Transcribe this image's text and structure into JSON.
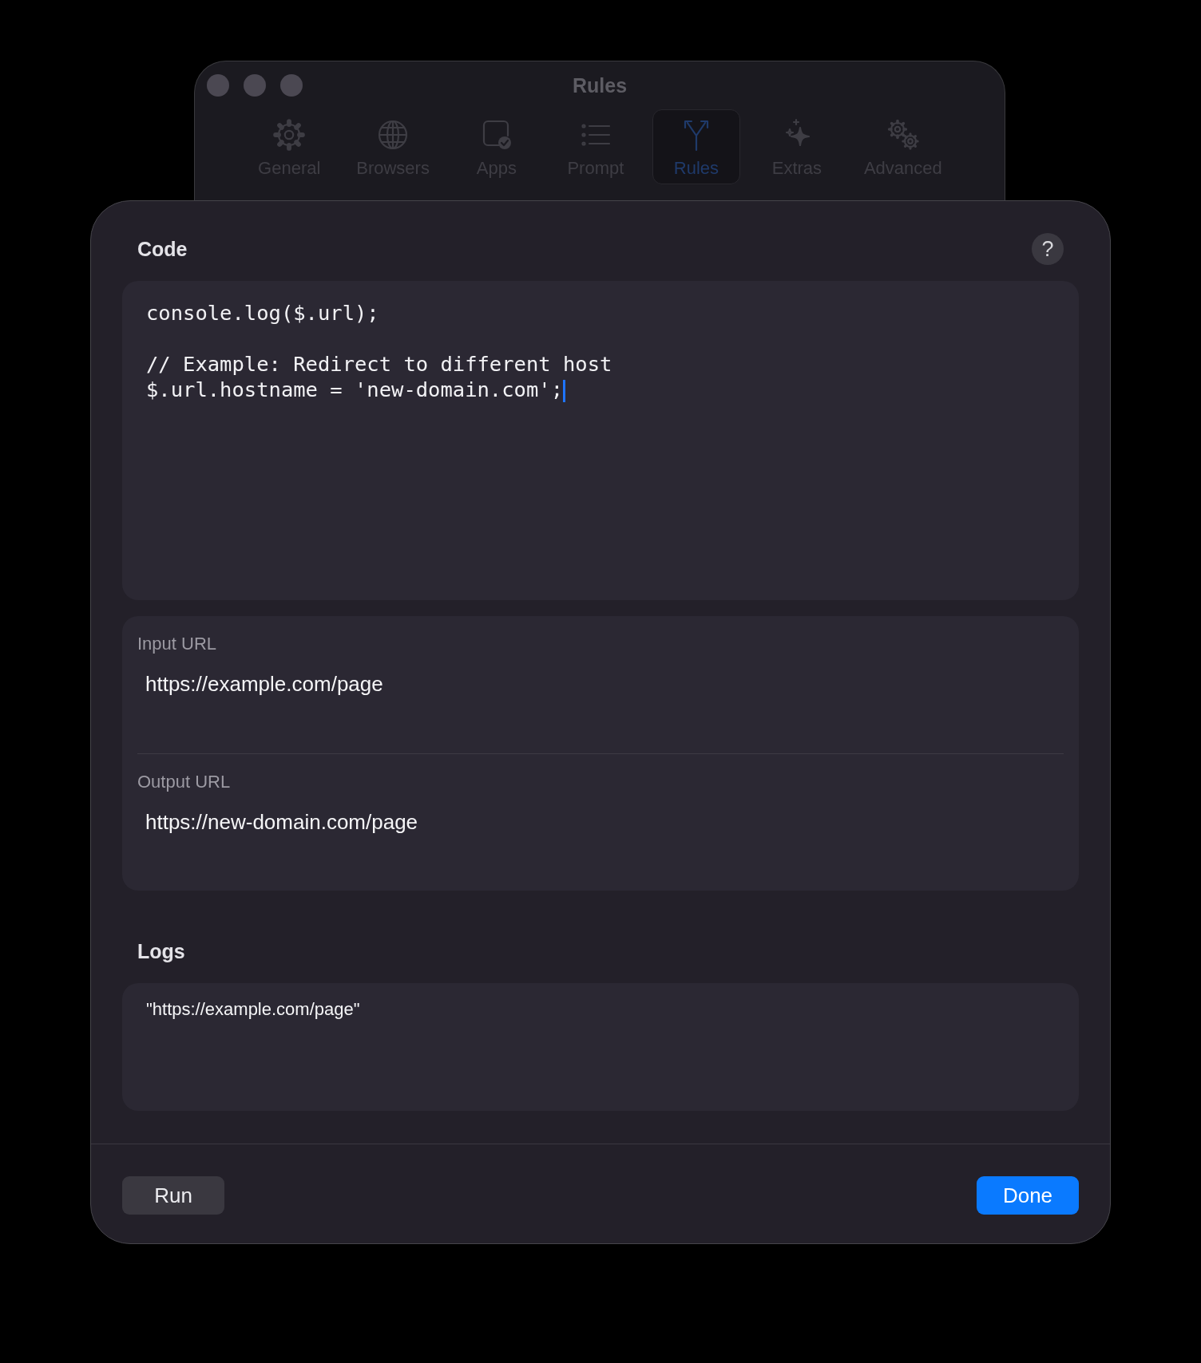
{
  "window": {
    "title": "Rules"
  },
  "tabs": [
    {
      "label": "General",
      "kind": "gear",
      "selected": false
    },
    {
      "label": "Browsers",
      "kind": "globe",
      "selected": false
    },
    {
      "label": "Apps",
      "kind": "app",
      "selected": false
    },
    {
      "label": "Prompt",
      "kind": "list",
      "selected": false
    },
    {
      "label": "Rules",
      "kind": "fork",
      "selected": true
    },
    {
      "label": "Extras",
      "kind": "sparkle",
      "selected": false
    },
    {
      "label": "Advanced",
      "kind": "gears",
      "selected": false
    }
  ],
  "sheet": {
    "code": {
      "title": "Code",
      "help": "?",
      "text": "console.log($.url);\n\n// Example: Redirect to different host\n$.url.hostname = 'new-domain.com';",
      "focused": true
    },
    "urls": [
      {
        "label": "Input URL",
        "value": "https://example.com/page"
      },
      {
        "label": "Output URL",
        "value": "https://new-domain.com/page"
      }
    ],
    "logs": {
      "title": "Logs",
      "lines": [
        "\"https://example.com/page\""
      ]
    },
    "buttons": [
      {
        "label": "Run",
        "kind": "secondary"
      },
      {
        "label": "Done",
        "kind": "primary"
      }
    ]
  }
}
